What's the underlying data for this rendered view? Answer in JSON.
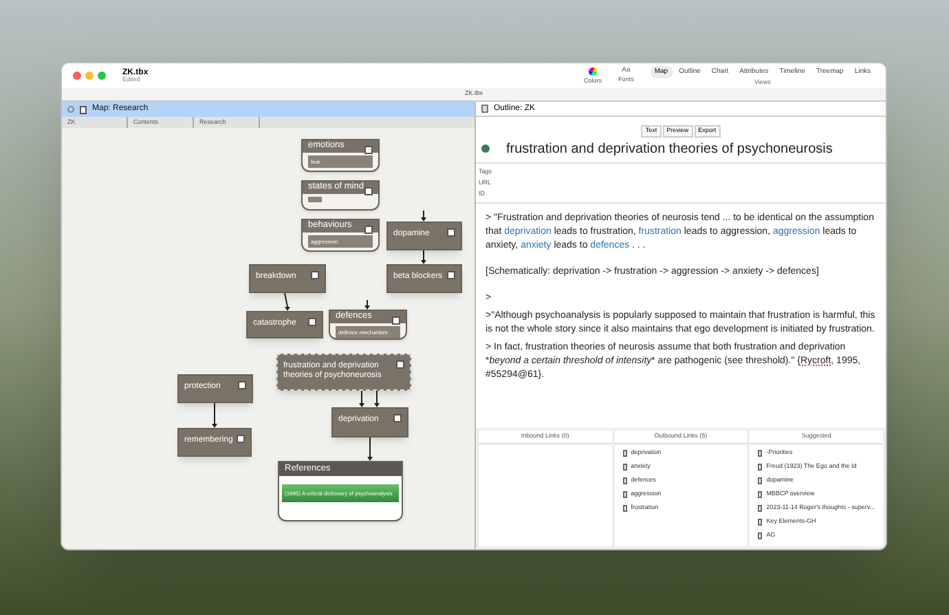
{
  "window": {
    "title": "ZK.tbx",
    "subtitle": "Edited",
    "tab_title": "ZK.tbx"
  },
  "toolbar": {
    "tools": [
      {
        "label": "Colors",
        "kind": "colors"
      },
      {
        "label": "Fonts",
        "kind": "fonts",
        "glyph": "Aa"
      }
    ],
    "views": [
      {
        "label": "Map",
        "selected": true
      },
      {
        "label": "Outline",
        "selected": false
      },
      {
        "label": "Chart",
        "selected": false
      },
      {
        "label": "Attributes",
        "selected": false
      },
      {
        "label": "Timeline",
        "selected": false
      },
      {
        "label": "Treemap",
        "selected": false
      },
      {
        "label": "Links",
        "selected": false
      }
    ],
    "views_label": "Views"
  },
  "map_pane": {
    "title": "Map: Research",
    "breadcrumbs": [
      "ZK",
      "Contents",
      "Research"
    ],
    "nodes": [
      {
        "title": "emotions",
        "kind": "container",
        "child": "fear",
        "selected": false
      },
      {
        "title": "states of mind",
        "kind": "container",
        "selected": false
      },
      {
        "title": "behaviours",
        "kind": "container",
        "child": "aggression",
        "selected": false
      },
      {
        "title": "dopamine",
        "kind": "note",
        "selected": false
      },
      {
        "title": "breakdown",
        "kind": "note",
        "selected": false
      },
      {
        "title": "beta blockers",
        "kind": "note",
        "selected": false
      },
      {
        "title": "catastrophe",
        "kind": "note",
        "selected": false
      },
      {
        "title": "defences",
        "kind": "container",
        "child": "defence mechanism",
        "selected": false
      },
      {
        "title": "frustration and deprivation theories of psychoneurosis",
        "kind": "note",
        "selected": true
      },
      {
        "title": "protection",
        "kind": "note",
        "selected": false
      },
      {
        "title": "deprivation",
        "kind": "note",
        "selected": false
      },
      {
        "title": "remembering",
        "kind": "note",
        "selected": false
      },
      {
        "title": "References",
        "kind": "reference",
        "child": "(1995) A critical dictionary of psychoanalysis",
        "selected": false
      }
    ]
  },
  "text_pane": {
    "title": "Outline: ZK",
    "tabs": [
      "Text",
      "Preview",
      "Export"
    ],
    "note_title": "frustration and deprivation theories of psychoneurosis",
    "attributes": [
      "Tags",
      "URL",
      "ID"
    ],
    "paragraphs": [
      [
        {
          "kind": "plain",
          "text": "> \"Frustration and deprivation theories of neurosis tend ... to be identical on the assumption that "
        },
        {
          "kind": "link",
          "text": "deprivation"
        },
        {
          "kind": "plain",
          "text": " leads to frustration, "
        },
        {
          "kind": "link",
          "text": "frustration"
        },
        {
          "kind": "plain",
          "text": " leads to aggression, "
        },
        {
          "kind": "link",
          "text": "aggression"
        },
        {
          "kind": "plain",
          "text": " leads to anxiety, "
        },
        {
          "kind": "link",
          "text": "anxiety"
        },
        {
          "kind": "plain",
          "text": " leads to "
        },
        {
          "kind": "link",
          "text": "defences"
        },
        {
          "kind": "plain",
          "text": " . . . "
        }
      ],
      [
        {
          "kind": "plain",
          "text": "[Schematically:  deprivation -> frustration -> aggression -> anxiety -> defences]"
        }
      ],
      [
        {
          "kind": "plain",
          "text": ">"
        }
      ],
      [
        {
          "kind": "plain",
          "text": ">\"Although psychoanalysis is popularly supposed to maintain that frustration is harmful, this is not the whole story since it also maintains that ego development is initiated by frustration."
        }
      ],
      [
        {
          "kind": "plain",
          "text": "> In fact, frustration theories of neurosis assume that both frustration and deprivation *"
        },
        {
          "kind": "italic",
          "text": "beyond a certain threshold of intensity"
        },
        {
          "kind": "plain",
          "text": "* are pathogenic (see threshold).\" {"
        },
        {
          "kind": "misspelled",
          "text": "Rycroft"
        },
        {
          "kind": "plain",
          "text": ", 1995, #55294@61}."
        }
      ]
    ],
    "links": [
      {
        "title": "Inbound Links (0)"
      },
      {
        "title": "Outbound Links (5)",
        "items": [
          "deprivation",
          "anxiety",
          "defences",
          "aggression",
          "frustration"
        ]
      },
      {
        "title": "Suggested",
        "items": [
          "-Priorities",
          "Freud (1923) The Ego and the Id",
          "dopamine",
          "MBBCP overview",
          "2023-11-14 Roger's thoughts - superv...",
          "Key Elements-GH",
          "AG"
        ]
      }
    ]
  }
}
